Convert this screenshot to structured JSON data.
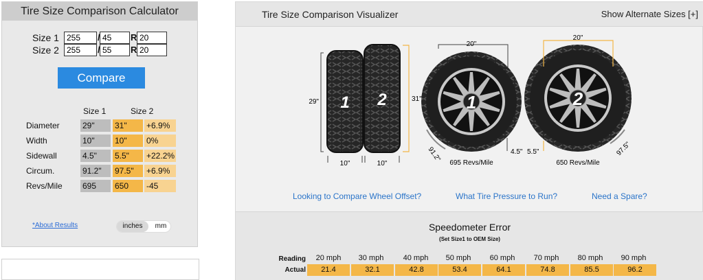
{
  "calculator": {
    "title": "Tire Size Comparison Calculator",
    "size1": {
      "label": "Size 1",
      "width": "255",
      "aspect": "45",
      "rim": "20"
    },
    "size2": {
      "label": "Size 2",
      "width": "255",
      "aspect": "55",
      "rim": "20"
    },
    "separator": "/",
    "rim_marker": "R",
    "compare_label": "Compare",
    "results": {
      "col1": "Size 1",
      "col2": "Size 2",
      "rows": [
        {
          "label": "Diameter",
          "size1": "29\"",
          "size2": "31\"",
          "diff": "+6.9%"
        },
        {
          "label": "Width",
          "size1": "10\"",
          "size2": "10\"",
          "diff": "0%"
        },
        {
          "label": "Sidewall",
          "size1": "4.5\"",
          "size2": "5.5\"",
          "diff": "+22.2%"
        },
        {
          "label": "Circum.",
          "size1": "91.2\"",
          "size2": "97.5\"",
          "diff": "+6.9%"
        },
        {
          "label": "Revs/Mile",
          "size1": "695",
          "size2": "650",
          "diff": "-45"
        }
      ]
    },
    "about_link": "*About Results",
    "units": {
      "inches": "inches",
      "mm": "mm",
      "selected": "inches"
    }
  },
  "visualizer": {
    "title": "Tire Size Comparison Visualizer",
    "alt_sizes": "Show Alternate Sizes [+]",
    "tire1_number": "1",
    "tire2_number": "2",
    "side_view": {
      "height1": "29\"",
      "height2": "31\"",
      "width1": "10\"",
      "width2": "10\""
    },
    "wheel1": {
      "rim": "20\"",
      "circum": "91.2\"",
      "sidewall": "4.5\"",
      "revs": "695 Revs/Mile"
    },
    "wheel2": {
      "rim": "20\"",
      "circum": "97.5\"",
      "sidewall": "5.5\"",
      "revs": "650 Revs/Mile"
    },
    "links": [
      "Looking to Compare Wheel Offset?",
      "What Tire Pressure to Run?",
      "Need a Spare?"
    ],
    "colors": {
      "accent": "#f4b748",
      "button": "#2b8ae0",
      "link": "#2a74c9"
    }
  },
  "speedometer": {
    "title": "Speedometer Error",
    "subtitle": "(Set Size1 to OEM Size)",
    "reading_label": "Reading",
    "actual_label": "Actual",
    "readings": [
      "20 mph",
      "30 mph",
      "40 mph",
      "50 mph",
      "60 mph",
      "70 mph",
      "80 mph",
      "90 mph"
    ],
    "actual": [
      "21.4",
      "32.1",
      "42.8",
      "53.4",
      "64.1",
      "74.8",
      "85.5",
      "96.2"
    ]
  }
}
